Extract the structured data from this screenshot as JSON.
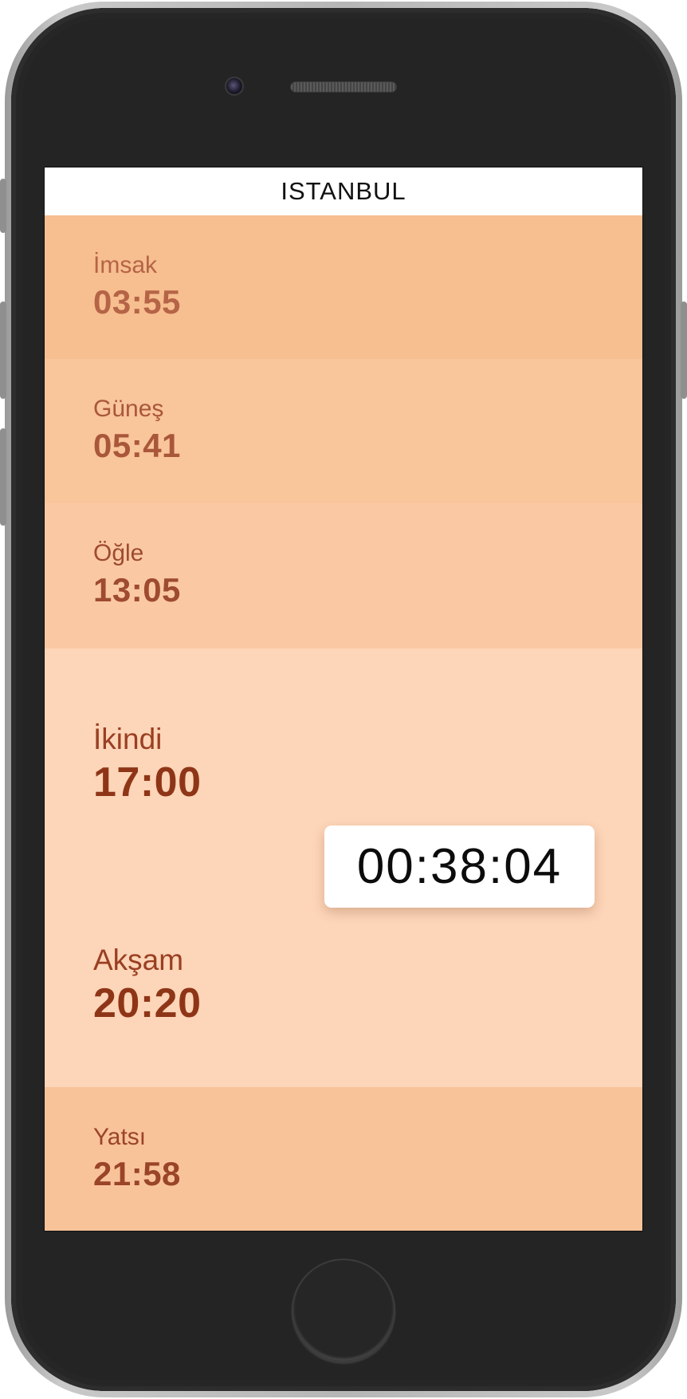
{
  "app": {
    "city": "ISTANBUL"
  },
  "prayers": [
    {
      "name": "İmsak",
      "time": "03:55"
    },
    {
      "name": "Güneş",
      "time": "05:41"
    },
    {
      "name": "Öğle",
      "time": "13:05"
    },
    {
      "name": "İkindi",
      "time": "17:00"
    },
    {
      "name": "Akşam",
      "time": "20:20"
    },
    {
      "name": "Yatsı",
      "time": "21:58"
    }
  ],
  "countdown": {
    "remaining": "00:38:04"
  },
  "colors": {
    "imsak_bg": "#f7be90",
    "gunes_bg": "#f9c59b",
    "ogle_bg": "#fac9a3",
    "current_bg": "#fdd5b8",
    "yatsi_bg": "#f9c39a",
    "text_accent": "#8f3517"
  }
}
